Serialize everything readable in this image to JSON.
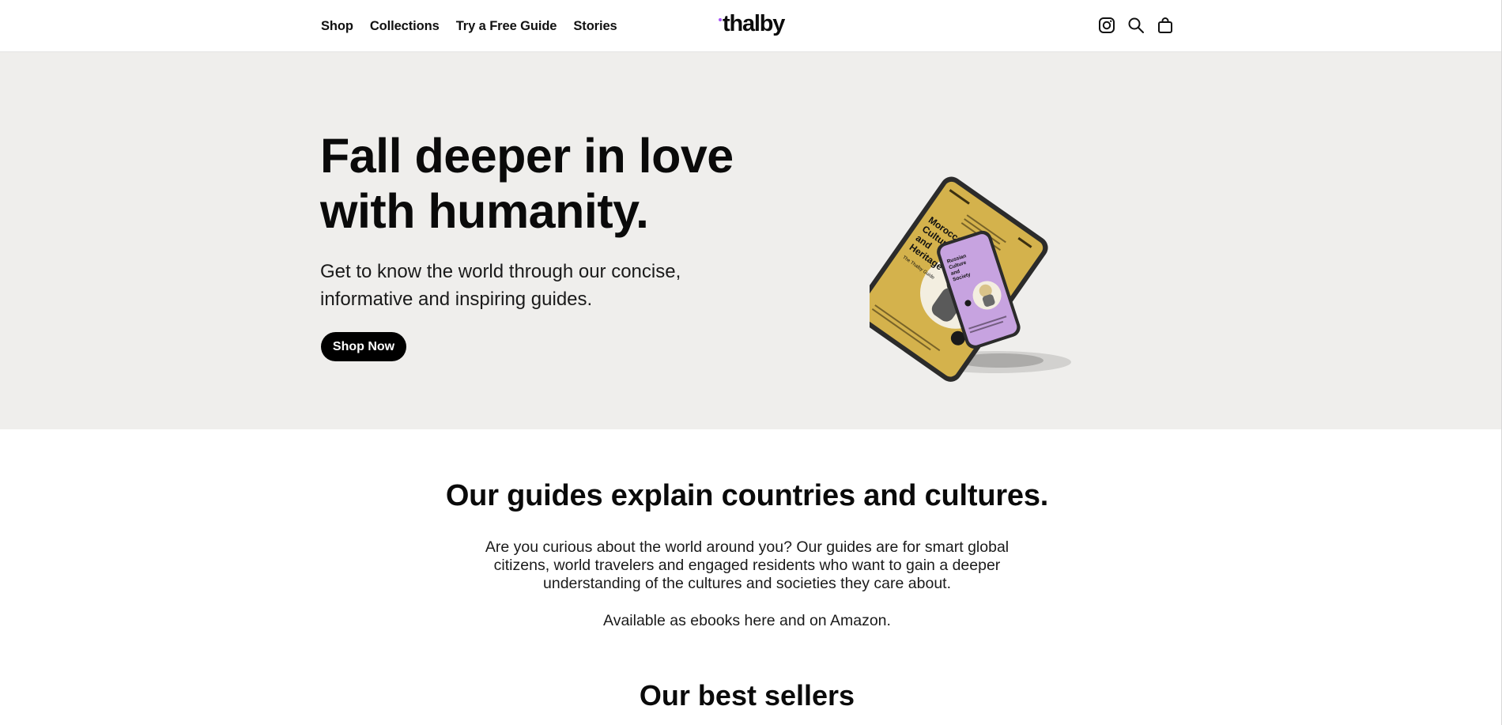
{
  "header": {
    "nav": [
      {
        "label": "Shop"
      },
      {
        "label": "Collections"
      },
      {
        "label": "Try a Free Guide"
      },
      {
        "label": "Stories"
      }
    ],
    "logo": "thalby",
    "logo_dot_color": "#a855f7",
    "icons": [
      "instagram-icon",
      "search-icon",
      "cart-icon"
    ]
  },
  "hero": {
    "title_line1": "Fall deeper in love",
    "title_line2": "with humanity.",
    "subtitle_line1": "Get to know the world through our concise,",
    "subtitle_line2": "informative and inspiring guides.",
    "cta": "Shop Now",
    "background": "#efeeec",
    "tablet_cover": {
      "title_lines": [
        "Moroccan",
        "Culture",
        "and",
        "Heritage"
      ],
      "subtitle": "The Thalby Guide",
      "color": "#d4b24c"
    },
    "phone_cover": {
      "title_lines": [
        "Russian",
        "Culture",
        "and",
        "Society"
      ],
      "color": "#c7a3e0"
    }
  },
  "intro": {
    "title": "Our guides explain countries and cultures.",
    "body_line1": "Are you curious about the world around you? Our guides are for smart global",
    "body_line2": "citizens, world travelers and engaged residents who want to gain a deeper",
    "body_line3": "understanding of the cultures and societies they care about.",
    "note": "Available as ebooks here and on Amazon."
  },
  "best_sellers": {
    "title": "Our best sellers"
  }
}
